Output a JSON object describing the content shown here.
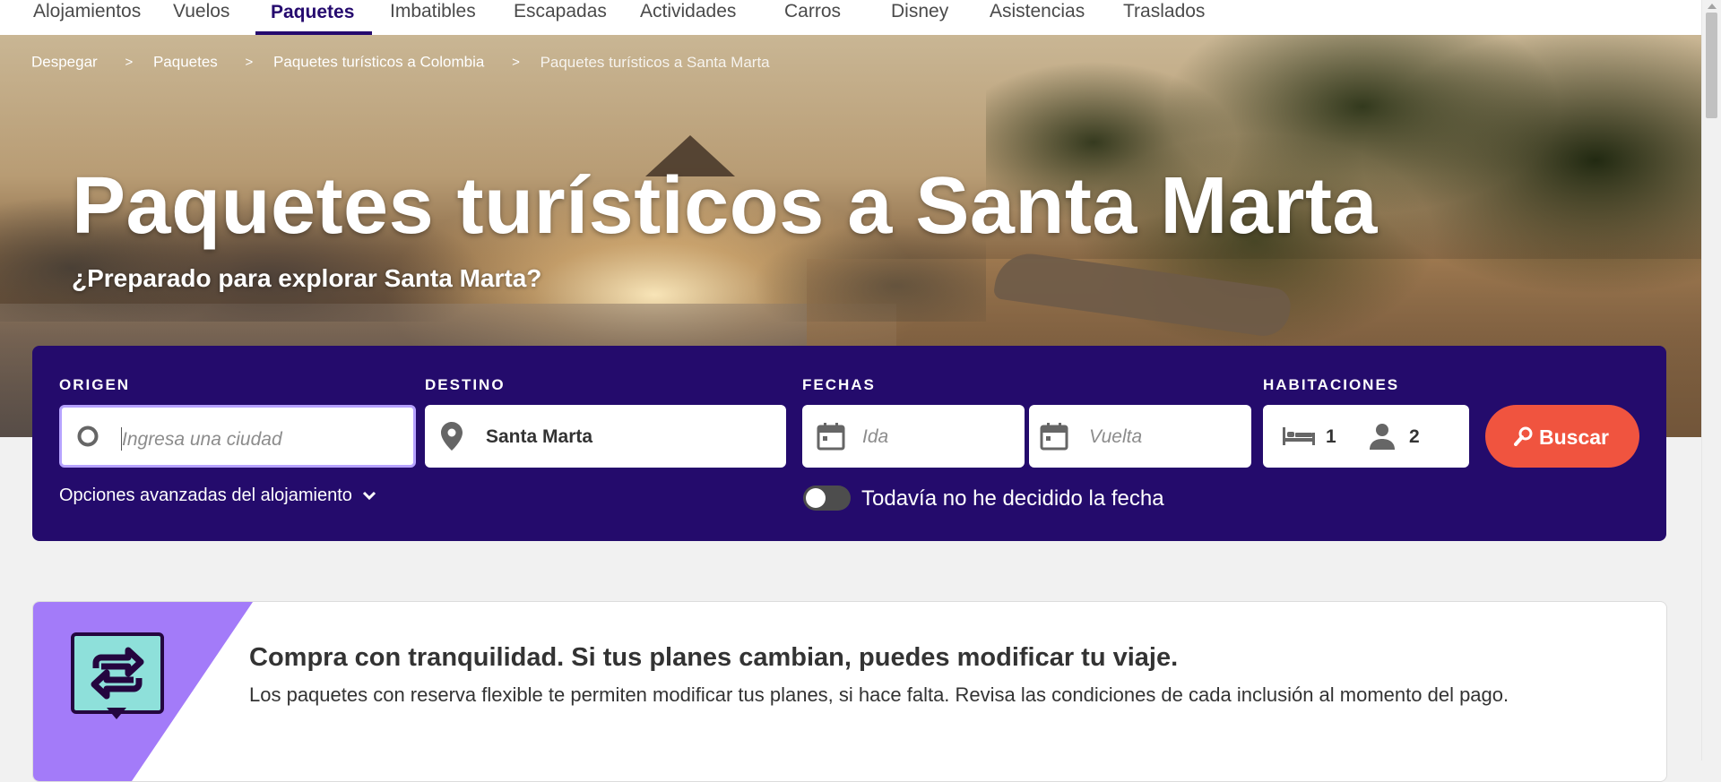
{
  "nav": {
    "tabs": [
      {
        "label": "Alojamientos"
      },
      {
        "label": "Vuelos"
      },
      {
        "label": "Paquetes",
        "active": true
      },
      {
        "label": "Imbatibles"
      },
      {
        "label": "Escapadas"
      },
      {
        "label": "Actividades"
      },
      {
        "label": "Carros"
      },
      {
        "label": "Disney"
      },
      {
        "label": "Asistencias"
      },
      {
        "label": "Traslados"
      }
    ]
  },
  "breadcrumb": {
    "items": [
      "Despegar",
      "Paquetes",
      "Paquetes turísticos a Colombia",
      "Paquetes turísticos a Santa Marta"
    ],
    "separator": ">"
  },
  "hero": {
    "title": "Paquetes turísticos a Santa Marta",
    "subtitle": "¿Preparado para explorar Santa Marta?"
  },
  "search": {
    "origin_label": "ORIGEN",
    "origin_placeholder": "Ingresa una ciudad",
    "origin_value": "",
    "destination_label": "DESTINO",
    "destination_value": "Santa Marta",
    "dates_label": "FECHAS",
    "departure_placeholder": "Ida",
    "return_placeholder": "Vuelta",
    "rooms_label": "HABITACIONES",
    "rooms_count": "1",
    "guests_count": "2",
    "search_button": "Buscar",
    "advanced_options": "Opciones avanzadas del alojamiento",
    "undecided_toggle_label": "Todavía no he decidido la fecha",
    "undecided_toggle_on": false
  },
  "info_card": {
    "headline": "Compra con tranquilidad. Si tus planes cambian, puedes modificar tu viaje.",
    "body": "Los paquetes con reserva flexible te permiten modificar tus planes, si hace falta. Revisa las condiciones de cada inclusión al momento del pago."
  },
  "colors": {
    "brand_purple": "#240b6c",
    "search_button": "#f0543f",
    "accent_lilac": "#a37bf9",
    "icon_teal": "#8ee0da"
  }
}
